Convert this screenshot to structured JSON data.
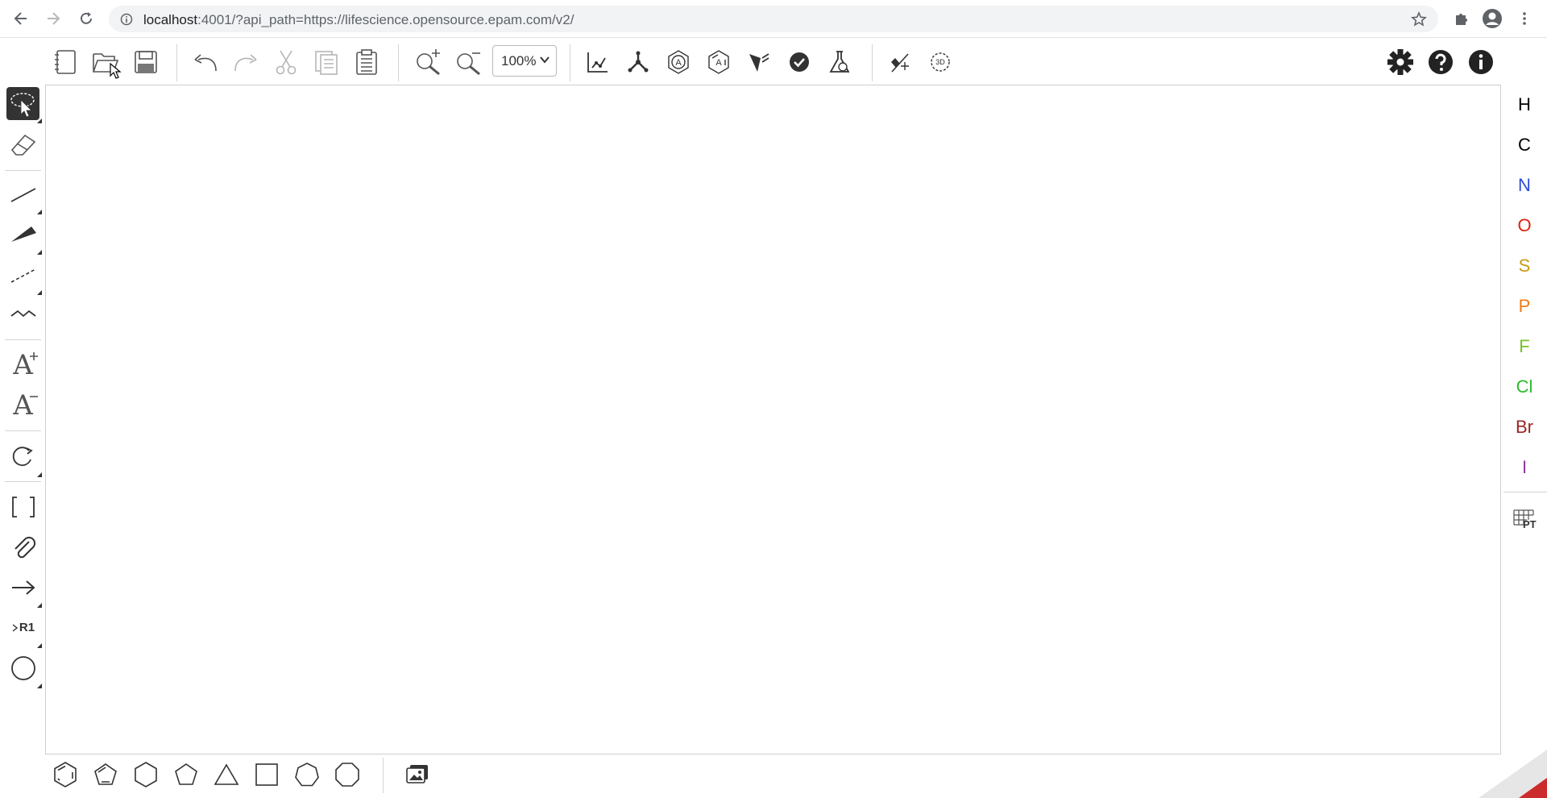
{
  "browser": {
    "url_host": "localhost",
    "url_rest": ":4001/?api_path=https://lifescience.opensource.epam.com/v2/"
  },
  "toolbar": {
    "zoom_value": "100%"
  },
  "left_tools": {
    "rgroup_label": "R1",
    "text_add_label": "A",
    "text_remove_label": "A"
  },
  "elements": [
    {
      "symbol": "H",
      "color": "#000000"
    },
    {
      "symbol": "C",
      "color": "#000000"
    },
    {
      "symbol": "N",
      "color": "#2d4bd8"
    },
    {
      "symbol": "O",
      "color": "#e0230f"
    },
    {
      "symbol": "S",
      "color": "#c79a13"
    },
    {
      "symbol": "P",
      "color": "#f07b12"
    },
    {
      "symbol": "F",
      "color": "#78c228"
    },
    {
      "symbol": "Cl",
      "color": "#2cbc2c"
    },
    {
      "symbol": "Br",
      "color": "#9f2424"
    },
    {
      "symbol": "I",
      "color": "#8f3ba0"
    }
  ],
  "periodic_table": {
    "label": "PT"
  },
  "icons": {
    "back": "arrow-left-icon",
    "forward": "arrow-right-icon",
    "reload": "reload-icon",
    "settings": "gear-icon",
    "help": "question-icon",
    "about": "info-icon"
  }
}
